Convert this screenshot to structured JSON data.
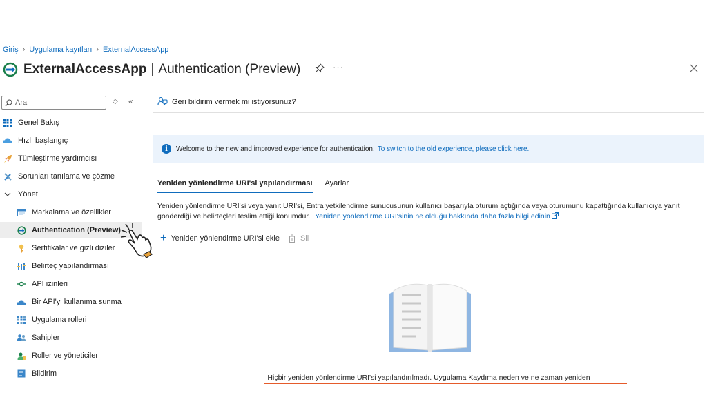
{
  "breadcrumb": {
    "items": [
      "Giriş",
      "Uygulama kayıtları",
      "ExternalAccessApp"
    ]
  },
  "header": {
    "app_name": "ExternalAccessApp",
    "separator": "|",
    "page_title": "Authentication (Preview)",
    "more": "···"
  },
  "sidebar": {
    "search_placeholder": "Ara",
    "toggle_symbol": "◇",
    "collapse_symbol": "«",
    "items": [
      {
        "label": "Genel Bakış",
        "icon": "grid-icon"
      },
      {
        "label": "Hızlı başlangıç",
        "icon": "cloud-icon"
      },
      {
        "label": "Tümleştirme yardımcısı",
        "icon": "rocket-icon"
      },
      {
        "label": "Sorunları tanılama ve çözme",
        "icon": "wrench-icon"
      },
      {
        "label": "Yönet",
        "icon": "chevron-down-icon"
      },
      {
        "label": "Markalama ve özellikler",
        "icon": "branding-icon"
      },
      {
        "label": "Authentication (Preview)",
        "icon": "authentication-icon",
        "active": true
      },
      {
        "label": "Sertifikalar ve gizli diziler",
        "icon": "key-icon"
      },
      {
        "label": "Belirteç yapılandırması",
        "icon": "token-bars-icon"
      },
      {
        "label": "API izinleri",
        "icon": "api-permissions-icon"
      },
      {
        "label": "Bir API'yi kullanıma sunma",
        "icon": "cloud-api-icon"
      },
      {
        "label": "Uygulama rolleri",
        "icon": "roles-grid-icon"
      },
      {
        "label": "Sahipler",
        "icon": "owners-icon"
      },
      {
        "label": "Roller ve yöneticiler",
        "icon": "admin-roles-icon"
      },
      {
        "label": "Bildirim",
        "icon": "manifest-icon"
      }
    ]
  },
  "main": {
    "feedback": "Geri bildirim vermek mi istiyorsunuz?",
    "banner": {
      "text": "Welcome to the new and improved experience for authentication.",
      "link": "To switch to the old experience, please click here."
    },
    "tabs": [
      {
        "label": "Yeniden yönlendirme URI'si yapılandırması",
        "active": true
      },
      {
        "label": "Ayarlar",
        "active": false
      }
    ],
    "description": "Yeniden yönlendirme URI'si veya yanıt URI'si, Entra yetkilendirme sunucusunun kullanıcı başarıyla oturum açtığında veya oturumunu kapattığında kullanıcıya yanıt gönderdiği ve belirteçleri teslim ettiği konumdur.",
    "description_link": "Yeniden yönlendirme URI'sinin ne olduğu hakkında daha fazla bilgi edinin",
    "toolbar": {
      "add_label": "Yeniden yönlendirme URI'si ekle",
      "delete_label": "Sil"
    },
    "empty_state": "Hiçbir yeniden yönlendirme URI'si yapılandırılmadı. Uygulama Kaydıma neden ve ne zaman yeniden"
  },
  "colors": {
    "accent": "#0f6cbd",
    "banner_bg": "#ebf3fc",
    "active_item_bg": "#ededed"
  }
}
